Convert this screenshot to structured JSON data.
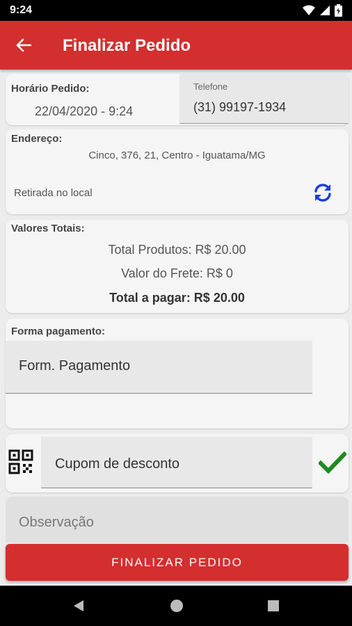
{
  "status_bar": {
    "time": "9:24",
    "icons": [
      "wifi-icon",
      "signal-icon",
      "battery-icon"
    ]
  },
  "app_bar": {
    "title": "Finalizar Pedido",
    "back_icon": "arrow-left-icon"
  },
  "order": {
    "time_label": "Horário Pedido:",
    "time_value": "22/04/2020 - 9:24",
    "phone_label": "Telefone",
    "phone_value": "(31) 99197-1934"
  },
  "address": {
    "label": "Endereço:",
    "value": "Cinco, 376, 21, Centro - Iguatama/MG",
    "pickup": "Retirada no local",
    "refresh_icon": "refresh-icon"
  },
  "totals": {
    "label": "Valores Totais:",
    "products": "Total Produtos: R$ 20.00",
    "shipping": "Valor do Frete: R$ 0",
    "total": "Total a pagar: R$ 20.00"
  },
  "payment": {
    "label": "Forma pagamento:",
    "value": "Form. Pagamento"
  },
  "coupon": {
    "placeholder": "Cupom de desconto",
    "qr_icon": "qr-code-icon",
    "check_icon": "check-icon"
  },
  "observation": {
    "placeholder": "Observação"
  },
  "finalize": {
    "label": "FINALIZAR PEDIDO"
  },
  "colors": {
    "primary": "#d32f2f",
    "refresh": "#1a3fd6",
    "check": "#1e8a1e"
  }
}
